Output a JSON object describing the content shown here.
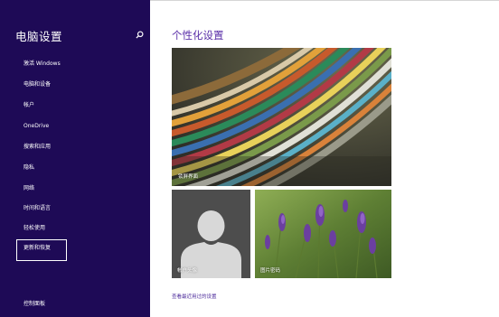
{
  "sidebar": {
    "title": "电脑设置",
    "search_icon": "search-icon",
    "items": [
      {
        "label": "激活 Windows",
        "selected": false
      },
      {
        "label": "电脑和设备",
        "selected": false
      },
      {
        "label": "帐户",
        "selected": false
      },
      {
        "label": "OneDrive",
        "selected": false
      },
      {
        "label": "搜索和应用",
        "selected": false
      },
      {
        "label": "隐私",
        "selected": false
      },
      {
        "label": "网络",
        "selected": false
      },
      {
        "label": "时间和语言",
        "selected": false
      },
      {
        "label": "轻松使用",
        "selected": false
      },
      {
        "label": "更新和恢复",
        "selected": true
      }
    ],
    "footer_link": "控制面板"
  },
  "main": {
    "title": "个性化设置",
    "tiles": {
      "lock_screen": "锁屏界面",
      "account_picture": "帐户头像",
      "picture_password": "图片密码"
    },
    "recent_link": "查看最近用过的设置"
  },
  "colors": {
    "sidebar_bg": "#1e0a56",
    "accent": "#5a2fa8"
  }
}
